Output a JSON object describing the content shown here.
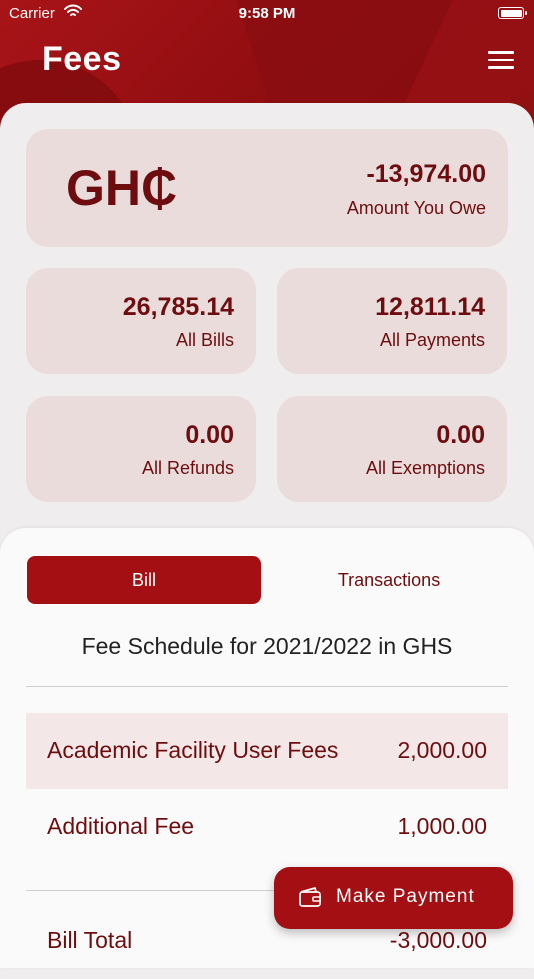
{
  "status_bar": {
    "carrier": "Carrier",
    "time": "9:58 PM"
  },
  "header": {
    "title": "Fees"
  },
  "summary": {
    "currency": "GH₵",
    "amount_owed": {
      "value": "-13,974.00",
      "label": "Amount You Owe"
    },
    "cards": [
      {
        "value": "26,785.14",
        "label": "All Bills"
      },
      {
        "value": "12,811.14",
        "label": "All Payments"
      },
      {
        "value": "0.00",
        "label": "All Refunds"
      },
      {
        "value": "0.00",
        "label": "All Exemptions"
      }
    ]
  },
  "tabs": {
    "bill": "Bill",
    "transactions": "Transactions"
  },
  "schedule": {
    "title": "Fee Schedule for 2021/2022 in GHS",
    "rows": [
      {
        "name": "Academic Facility User Fees",
        "amount": "2,000.00"
      },
      {
        "name": "Additional Fee",
        "amount": "1,000.00"
      }
    ],
    "total": {
      "name": "Bill Total",
      "amount": "-3,000.00"
    }
  },
  "actions": {
    "make_payment": "Make Payment"
  },
  "colors": {
    "primary": "#a30f13",
    "text_dark_red": "#6e0d0f",
    "card_bg": "#eadcdb"
  },
  "icons": {
    "menu": "hamburger-icon",
    "payment": "wallet-icon",
    "wifi": "wifi-icon",
    "battery": "battery-icon"
  }
}
